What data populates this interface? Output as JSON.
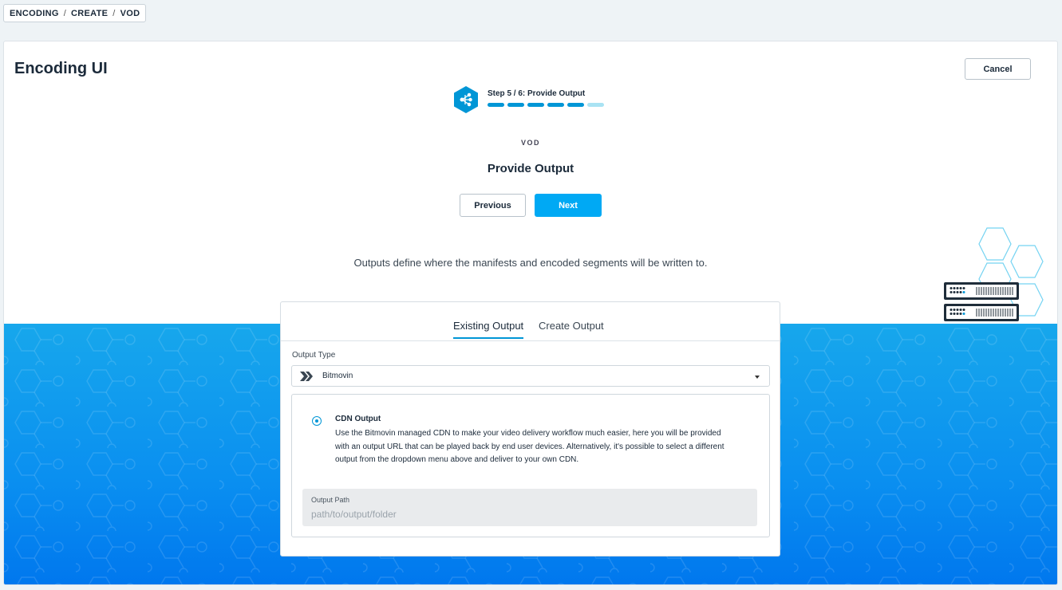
{
  "breadcrumb": {
    "items": [
      "ENCODING",
      "CREATE",
      "VOD"
    ],
    "separator": "/"
  },
  "page_title": "Encoding UI",
  "cancel_label": "Cancel",
  "step": {
    "label": "Step 5 / 6: Provide Output",
    "current": 5,
    "total": 6
  },
  "category": "VOD",
  "section_title": "Provide Output",
  "previous_label": "Previous",
  "next_label": "Next",
  "description": "Outputs define where the manifests and encoded segments will be written to.",
  "tabs": [
    {
      "label": "Existing Output",
      "active": true
    },
    {
      "label": "Create Output",
      "active": false
    }
  ],
  "output_type": {
    "label": "Output Type",
    "selected": "Bitmovin"
  },
  "cdn_option": {
    "title": "CDN Output",
    "description": "Use the Bitmovin managed CDN to make your video delivery workflow much easier, here you will be provided with an output URL that can be played back by end user devices. Alternatively, it's possible to select a different output from the dropdown menu above and deliver to your own CDN.",
    "selected": true
  },
  "output_path": {
    "label": "Output Path",
    "placeholder": "path/to/output/folder",
    "value": ""
  },
  "colors": {
    "accent": "#00a9f4",
    "primary_dark": "#0096d6",
    "progress_todo": "#a9e3f3",
    "text": "#1b2a3a"
  },
  "icons": {
    "step": "encoding-hexagon-icon",
    "select_logo": "bitmovin-logo-icon",
    "illustration": "server-hexagons-illustration"
  }
}
